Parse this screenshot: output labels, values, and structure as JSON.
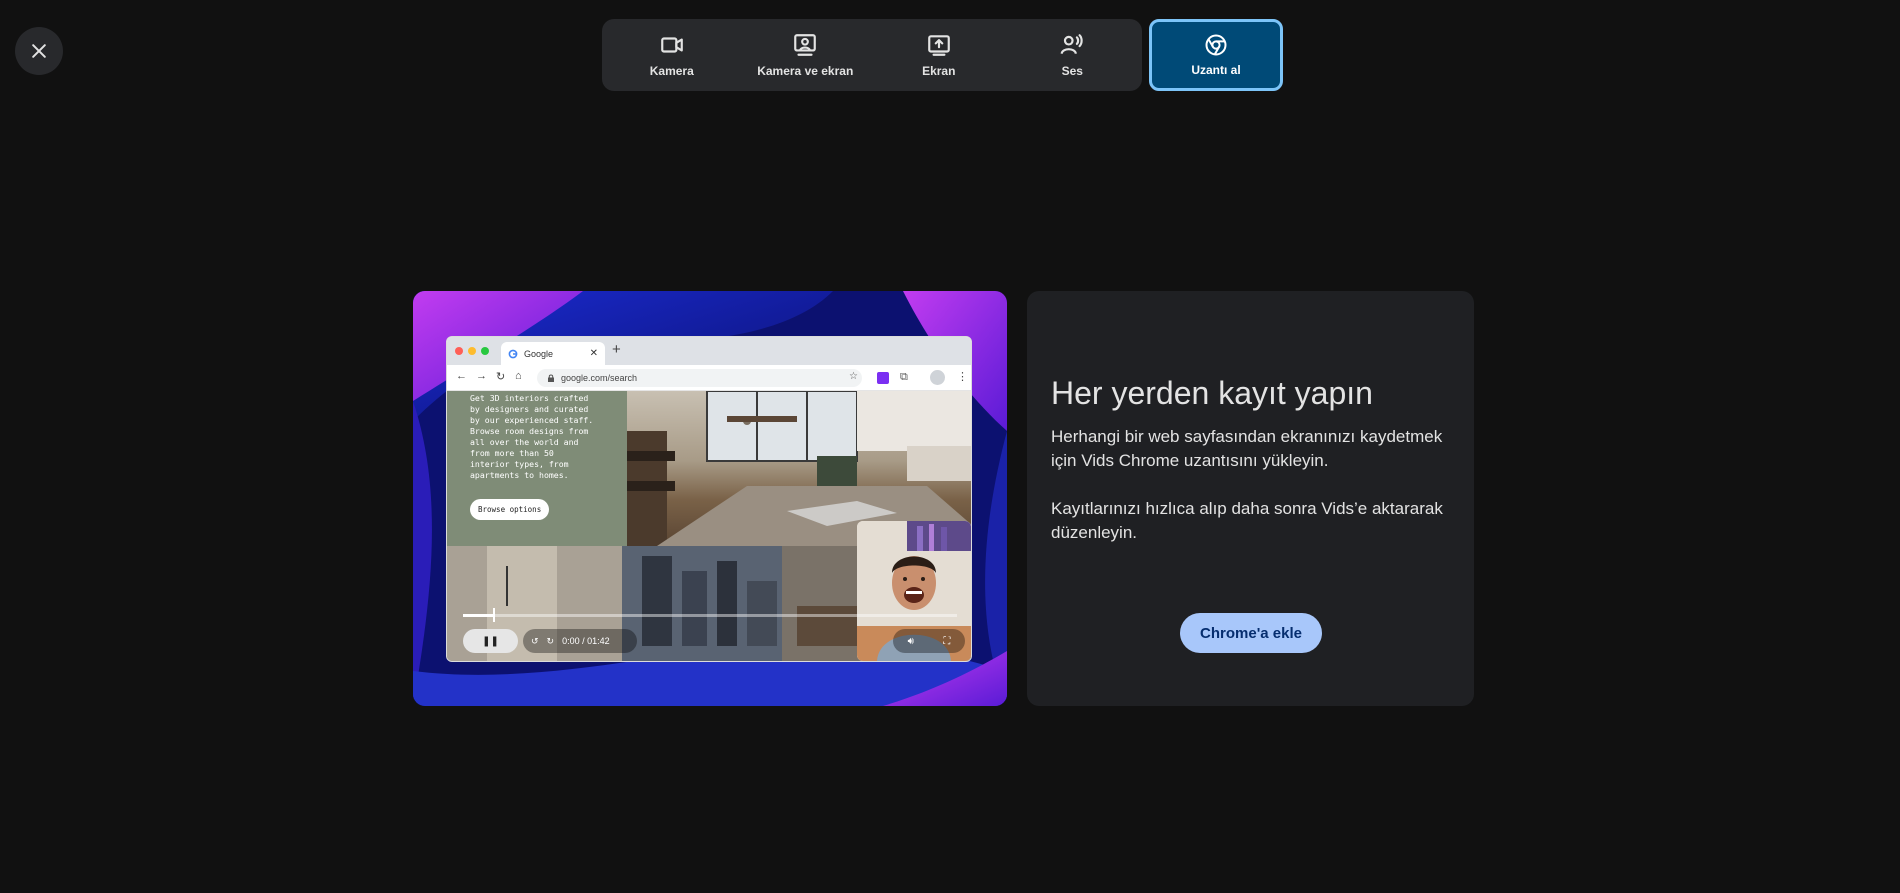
{
  "close": {
    "icon": "close-icon"
  },
  "modes": [
    {
      "label": "Kamera",
      "icon": "camera-icon"
    },
    {
      "label": "Kamera ve ekran",
      "icon": "camera-screen-icon"
    },
    {
      "label": "Ekran",
      "icon": "screen-share-icon"
    },
    {
      "label": "Ses",
      "icon": "voice-icon"
    }
  ],
  "extension_mode": {
    "label": "Uzantı al",
    "icon": "chrome-icon",
    "active_color": "#004a77",
    "active_border": "#7cc4f8"
  },
  "illustration": {
    "browser": {
      "tab_title": "Google",
      "url": "google.com/search"
    },
    "promo_text": "Get 3D interiors crafted\nby designers and curated\nby our experienced staff.\nBrowse room designs from\nall over the world and\nfrom more than 50\ninterior types, from\napartments to homes.",
    "promo_button": "Browse options",
    "player": {
      "time": "0:00 / 01:42",
      "progress": 0.06
    }
  },
  "info": {
    "title": "Her yerden kayıt yapın",
    "description_1": "Herhangi bir web sayfasından ekranınızı kaydetmek için Vids Chrome uzantısını yükleyin.",
    "description_2": "Kayıtlarınızı hızlıca alıp daha sonra Vids’e aktararak düzenleyin.",
    "button_label": "Chrome'a ekle",
    "button_color": "#a8c7fa"
  }
}
